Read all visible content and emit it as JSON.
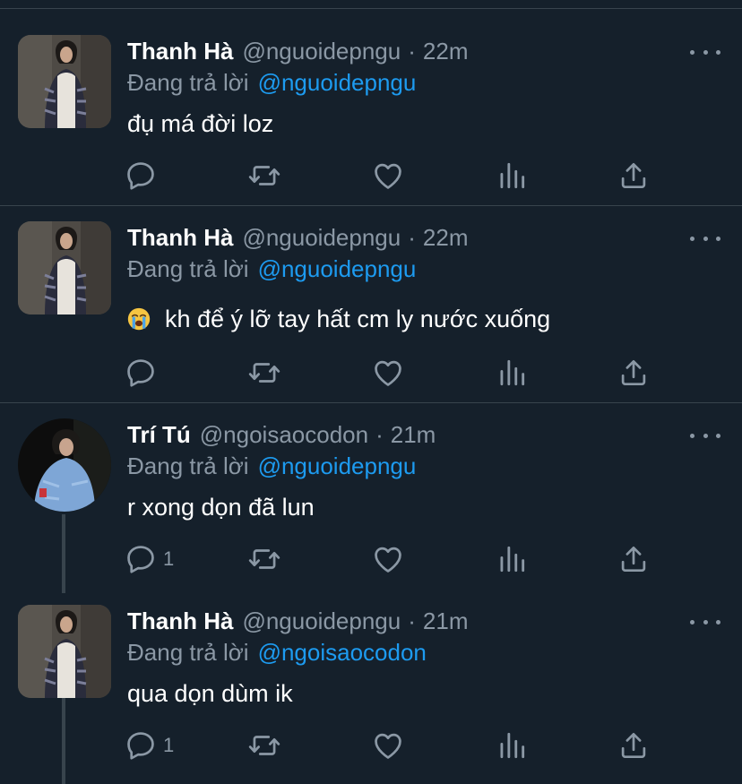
{
  "reply_prefix": "Đang trả lời",
  "tweets": [
    {
      "name": "Thanh Hà",
      "handle": "@nguoidepngu",
      "separator": "·",
      "time": "22m",
      "reply_to": "@nguoidepngu",
      "text": "đụ má đời loz",
      "reply_count": ""
    },
    {
      "name": "Thanh Hà",
      "handle": "@nguoidepngu",
      "separator": "·",
      "time": "22m",
      "reply_to": "@nguoidepngu",
      "emoji": "loudly-crying-face",
      "text": "kh để ý lỡ tay hất cm ly nước xuống",
      "reply_count": ""
    },
    {
      "name": "Trí Tú",
      "handle": "@ngoisaocodon",
      "separator": "·",
      "time": "21m",
      "reply_to": "@nguoidepngu",
      "text": "r xong dọn đã lun",
      "reply_count": "1"
    },
    {
      "name": "Thanh Hà",
      "handle": "@nguoidepngu",
      "separator": "·",
      "time": "21m",
      "reply_to": "@ngoisaocodon",
      "text": "qua dọn dùm ik",
      "reply_count": "1"
    }
  ],
  "colors": {
    "background": "#15202b",
    "divider": "#38444d",
    "secondary_text": "#8b98a5",
    "mention": "#1d9bf0"
  }
}
